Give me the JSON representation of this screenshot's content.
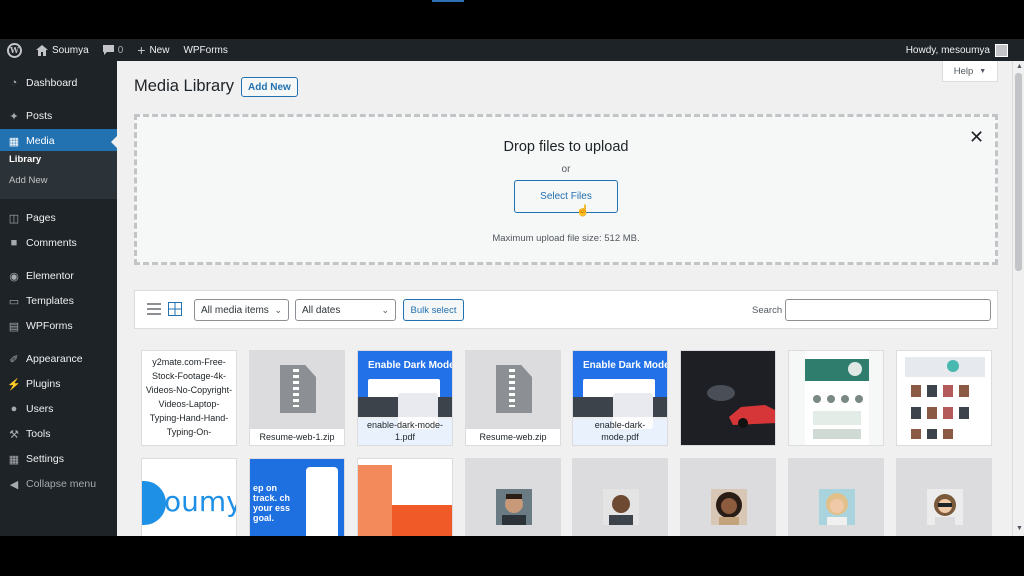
{
  "adminbar": {
    "site_name": "Soumya",
    "comments_count": "0",
    "new_label": "New",
    "wpforms_label": "WPForms",
    "howdy": "Howdy, mesoumya"
  },
  "sidebar": {
    "items": [
      {
        "label": "Dashboard",
        "icon": "dashboard-icon"
      },
      {
        "label": "Posts",
        "icon": "pin-icon"
      },
      {
        "label": "Media",
        "icon": "media-icon"
      },
      {
        "label": "Pages",
        "icon": "page-icon"
      },
      {
        "label": "Comments",
        "icon": "comment-icon"
      },
      {
        "label": "Elementor",
        "icon": "elementor-icon"
      },
      {
        "label": "Templates",
        "icon": "folder-icon"
      },
      {
        "label": "WPForms",
        "icon": "form-icon"
      },
      {
        "label": "Appearance",
        "icon": "brush-icon"
      },
      {
        "label": "Plugins",
        "icon": "plug-icon"
      },
      {
        "label": "Users",
        "icon": "user-icon"
      },
      {
        "label": "Tools",
        "icon": "wrench-icon"
      },
      {
        "label": "Settings",
        "icon": "settings-icon"
      },
      {
        "label": "Collapse menu",
        "icon": "collapse-icon"
      }
    ],
    "submenu": [
      {
        "label": "Library"
      },
      {
        "label": "Add New"
      }
    ],
    "active_item": "Media",
    "accent_color": "#2271b1"
  },
  "main": {
    "page_title": "Media Library",
    "add_new_label": "Add New",
    "help_label": "Help",
    "upload": {
      "title": "Drop files to upload",
      "or_text": "or",
      "select_label": "Select Files",
      "max_size": "Maximum upload file size: 512 MB."
    },
    "toolbar": {
      "filter_type": "All media items",
      "filter_date": "All dates",
      "bulk_select": "Bulk select",
      "search_label": "Search",
      "search_value": ""
    },
    "attachments": [
      {
        "name": "y2mate.com-Free-Stock-Footage-4k-Videos-No-Copyright-Videos-Laptop-Typing-Hand-Hand-Typing-On-",
        "kind": "document"
      },
      {
        "name": "Resume-web-1.zip",
        "kind": "archive"
      },
      {
        "name": "enable-dark-mode-1.pdf",
        "kind": "pdf",
        "preview_text": "Enable Dark Mode"
      },
      {
        "name": "Resume-web.zip",
        "kind": "archive"
      },
      {
        "name": "enable-dark-mode.pdf",
        "kind": "pdf",
        "preview_text": "Enable Dark Mode"
      },
      {
        "name": "",
        "kind": "image"
      },
      {
        "name": "",
        "kind": "image"
      },
      {
        "name": "",
        "kind": "image"
      },
      {
        "name": "",
        "kind": "image",
        "preview_text": "oumy"
      },
      {
        "name": "",
        "kind": "image",
        "preview_text": "ep on track. ch your ess goal."
      },
      {
        "name": "",
        "kind": "image"
      },
      {
        "name": "",
        "kind": "image"
      },
      {
        "name": "",
        "kind": "image"
      },
      {
        "name": "",
        "kind": "image"
      },
      {
        "name": "",
        "kind": "image"
      },
      {
        "name": "",
        "kind": "image"
      }
    ]
  }
}
